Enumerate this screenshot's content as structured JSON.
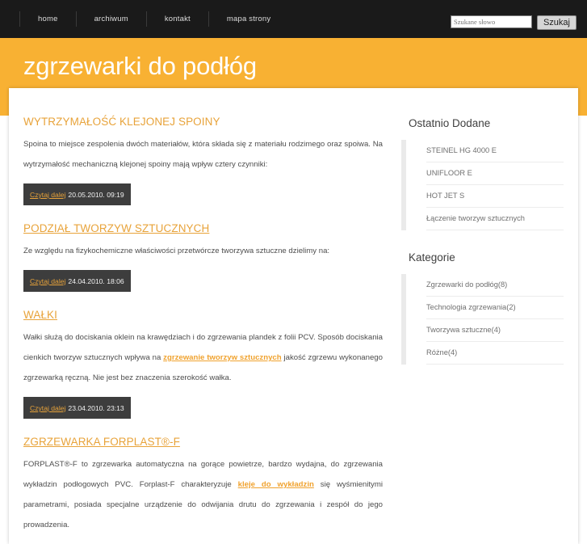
{
  "header": {
    "nav": [
      {
        "label": "home"
      },
      {
        "label": "archiwum"
      },
      {
        "label": "kontakt"
      },
      {
        "label": "mapa strony"
      }
    ],
    "search": {
      "placeholder": "Szukane słowo",
      "value": "",
      "button_label": "Szukaj"
    }
  },
  "banner": {
    "title": "zgrzewarki do podłóg",
    "color": "#f8b133"
  },
  "colors": {
    "accent": "#e8a33a",
    "header_bg": "#1a1a1a",
    "badge_bg": "#3d3d3d",
    "body_text": "#4d4d4d"
  },
  "main": {
    "articles": [
      {
        "title": "WYTRZYMAŁOŚĆ KLEJONEJ SPOINY",
        "underlined": false,
        "body_pre": "Spoina to miejsce zespolenia dwóch materiałów, która składa się z materiału rodzimego oraz spoiwa. Na wytrzymałość mechaniczną klejonej spoiny mają wpływ cztery czynniki:",
        "link_text": "",
        "body_post": "",
        "readmore_label": "Czytaj dalej",
        "date": "20.05.2010. 09:19"
      },
      {
        "title": "PODZIAŁ TWORZYW SZTUCZNYCH",
        "underlined": true,
        "body_pre": "Ze względu na fizykochemiczne właściwości przetwórcze tworzywa sztuczne dzielimy na:",
        "link_text": "",
        "body_post": "",
        "readmore_label": "Czytaj dalej",
        "date": "24.04.2010. 18:06"
      },
      {
        "title": "WAŁKI",
        "underlined": true,
        "body_pre": "Wałki służą do dociskania oklein na krawędziach i do zgrzewania plandek z folii PCV. Sposób dociskania cienkich tworzyw sztucznych wpływa na ",
        "link_text": "zgrzewanie tworzyw sztucznych",
        "body_post": " jakość zgrzewu wykonanego zgrzewarką ręczną. Nie jest bez znaczenia szerokość wałka.",
        "readmore_label": "Czytaj dalej",
        "date": "23.04.2010. 23:13"
      },
      {
        "title": "ZGRZEWARKA FORPLAST®-F",
        "underlined": true,
        "body_pre": "FORPLAST®-F to zgrzewarka automatyczna na gorące powietrze, bardzo wydajna, do zgrzewania wykładzin podłogowych PVC. Forplast-F charakteryzuje ",
        "link_text": "kleje do wykładzin",
        "body_post": " się wyśmienitymi parametrami, posiada specjalne urządzenie do odwijania drutu do zgrzewania i zespół do jego prowadzenia.",
        "readmore_label": "",
        "date": ""
      }
    ]
  },
  "sidebar": {
    "blocks": [
      {
        "heading": "Ostatnio Dodane",
        "items": [
          {
            "label": "STEINEL HG 4000 E"
          },
          {
            "label": "UNIFLOOR E"
          },
          {
            "label": "HOT JET S"
          },
          {
            "label": "Łączenie tworzyw sztucznych"
          }
        ]
      },
      {
        "heading": "Kategorie",
        "items": [
          {
            "label": "Zgrzewarki do podłóg(8)"
          },
          {
            "label": "Technologia zgrzewania(2)"
          },
          {
            "label": "Tworzywa sztuczne(4)"
          },
          {
            "label": "Różne(4)"
          }
        ]
      }
    ]
  }
}
